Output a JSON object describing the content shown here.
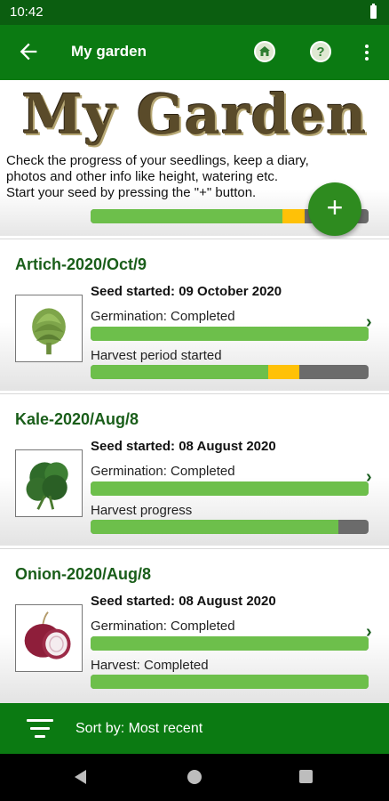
{
  "status_bar": {
    "time": "10:42"
  },
  "app_bar": {
    "title": "My garden",
    "icons": [
      "back-arrow-icon",
      "home-icon",
      "help-icon",
      "more-vert-icon"
    ]
  },
  "header": {
    "logo_text": "My Garden",
    "intro_lines": [
      "Check the progress of your seedlings, keep a diary,",
      "photos and other info like height, watering etc.",
      "Start your seed by pressing the \"+\" button."
    ],
    "progress": {
      "green": 0.69,
      "yellow": 0.08
    },
    "fab_label": "+"
  },
  "cards": [
    {
      "name": "Artich-2020/Oct/9",
      "seed": "Seed started: 09 October 2020",
      "germination_label": "Germination: Completed",
      "germination_progress": 1.0,
      "harvest_label": "Harvest period started",
      "harvest_progress": {
        "green": 0.64,
        "yellow": 0.11
      },
      "icon": "artichoke-image"
    },
    {
      "name": "Kale-2020/Aug/8",
      "seed": "Seed started: 08 August 2020",
      "germination_label": "Germination: Completed",
      "germination_progress": 1.0,
      "harvest_label": "Harvest progress",
      "harvest_progress": {
        "green": 0.89,
        "yellow": 0.0
      },
      "icon": "kale-image"
    },
    {
      "name": "Onion-2020/Aug/8",
      "seed": "Seed started: 08 August 2020",
      "germination_label": "Germination: Completed",
      "germination_progress": 1.0,
      "harvest_label": "Harvest: Completed",
      "harvest_progress": {
        "green": 1.0,
        "yellow": 0.0
      },
      "icon": "onion-image"
    }
  ],
  "sort_bar": {
    "label": "Sort by: Most recent"
  },
  "colors": {
    "primary": "#0b7a12",
    "progress_green": "#6dbf4b",
    "progress_yellow": "#ffc107",
    "progress_gray": "#6b6b6b"
  }
}
